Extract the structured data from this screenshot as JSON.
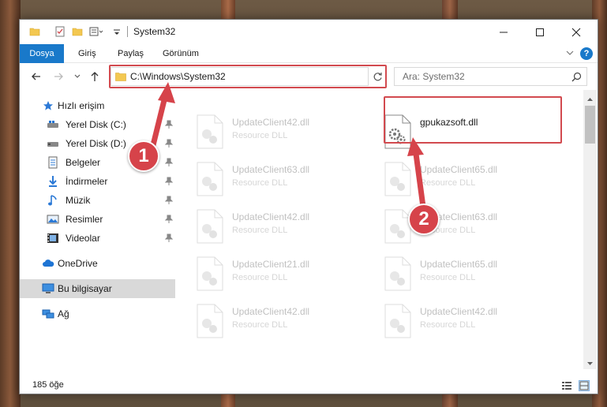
{
  "window": {
    "title": "System32",
    "minimize_icon": "minimize-icon",
    "maximize_icon": "maximize-icon",
    "close_icon": "close-icon"
  },
  "ribbon": {
    "tabs": [
      {
        "label": "Dosya"
      },
      {
        "label": "Giriş"
      },
      {
        "label": "Paylaş"
      },
      {
        "label": "Görünüm"
      }
    ],
    "help_label": "?"
  },
  "address": {
    "path": "C:\\Windows\\System32",
    "search_placeholder": "Ara: System32"
  },
  "nav_pane": {
    "items": [
      {
        "label": "Hızlı erişim",
        "icon": "star-icon"
      },
      {
        "label": "Yerel Disk (C:)",
        "icon": "drive-icon",
        "pinned": true
      },
      {
        "label": "Yerel Disk (D:)",
        "icon": "drive-icon",
        "pinned": true
      },
      {
        "label": "Belgeler",
        "icon": "documents-icon",
        "pinned": true
      },
      {
        "label": "İndirmeler",
        "icon": "downloads-icon",
        "pinned": true
      },
      {
        "label": "Müzik",
        "icon": "music-icon",
        "pinned": true
      },
      {
        "label": "Resimler",
        "icon": "pictures-icon",
        "pinned": true
      },
      {
        "label": "Videolar",
        "icon": "videos-icon",
        "pinned": true
      },
      {
        "label": "OneDrive",
        "icon": "cloud-icon"
      },
      {
        "label": "Bu bilgisayar",
        "icon": "computer-icon",
        "selected": true
      },
      {
        "label": "Ağ",
        "icon": "network-icon"
      }
    ]
  },
  "files": [
    {
      "name": "UpdateClient42.dll",
      "type": "Resource DLL",
      "faded": true
    },
    {
      "name": "gpukazsoft.dll",
      "type": "",
      "faded": false
    },
    {
      "name": "UpdateClient63.dll",
      "type": "Resource DLL",
      "faded": true
    },
    {
      "name": "UpdateClient65.dll",
      "type": "Resource DLL",
      "faded": true
    },
    {
      "name": "UpdateClient42.dll",
      "type": "Resource DLL",
      "faded": true
    },
    {
      "name": "UpdateClient63.dll",
      "type": "Resource DLL",
      "faded": true
    },
    {
      "name": "UpdateClient21.dll",
      "type": "Resource DLL",
      "faded": true
    },
    {
      "name": "UpdateClient65.dll",
      "type": "Resource DLL",
      "faded": true
    },
    {
      "name": "UpdateClient42.dll",
      "type": "Resource DLL",
      "faded": true
    },
    {
      "name": "UpdateClient42.dll",
      "type": "Resource DLL",
      "faded": true
    }
  ],
  "status": {
    "item_count": "185 öğe"
  },
  "annotations": {
    "step1": "1",
    "step2": "2",
    "color": "#d6434a"
  }
}
